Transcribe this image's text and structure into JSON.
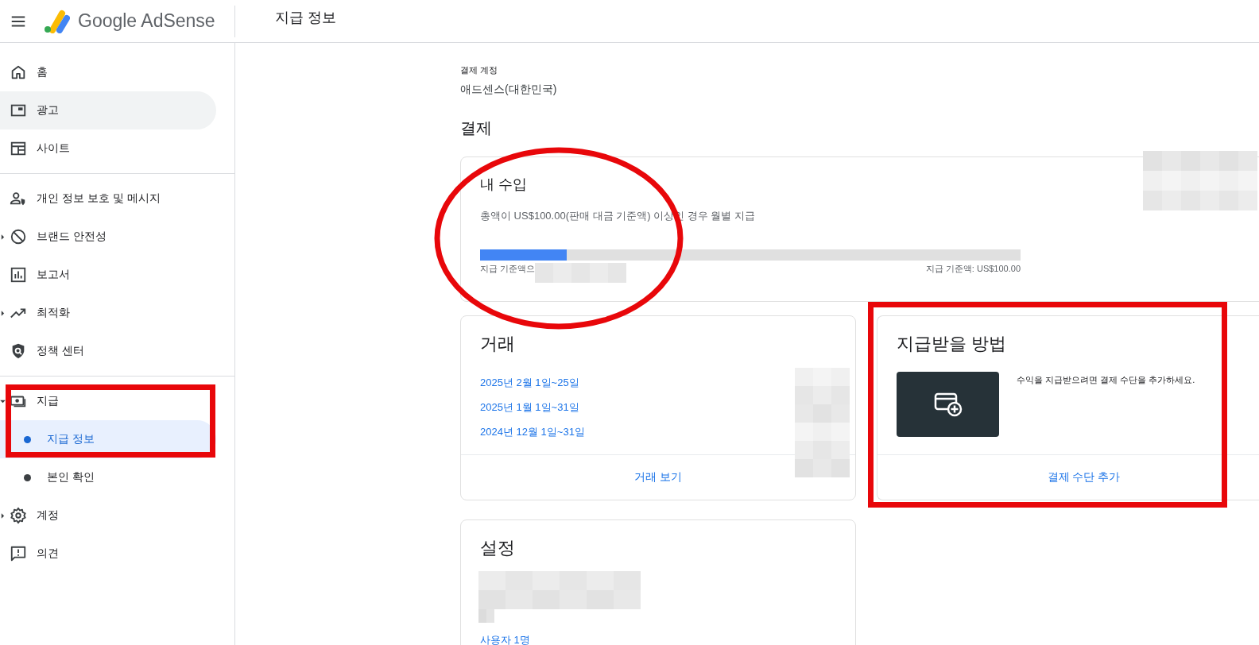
{
  "app": {
    "product_name": "Google AdSense"
  },
  "header": {
    "title": "지급 정보"
  },
  "sidebar": {
    "sections": [
      [
        {
          "label": "홈",
          "hovered": false,
          "expandable": false
        },
        {
          "label": "광고",
          "hovered": true,
          "expandable": false
        },
        {
          "label": "사이트",
          "hovered": false,
          "expandable": false
        }
      ],
      [
        {
          "label": "개인 정보 보호 및 메시지",
          "hovered": false,
          "expandable": false
        },
        {
          "label": "브랜드 안전성",
          "hovered": false,
          "expandable": true,
          "expanded": false
        },
        {
          "label": "보고서",
          "hovered": false,
          "expandable": false
        },
        {
          "label": "최적화",
          "hovered": false,
          "expandable": true,
          "expanded": false
        },
        {
          "label": "정책 센터",
          "hovered": false,
          "expandable": false
        }
      ],
      [
        {
          "label": "지급",
          "hovered": false,
          "expandable": true,
          "expanded": true,
          "children": [
            {
              "label": "지급 정보",
              "selected": true
            },
            {
              "label": "본인 확인",
              "selected": false
            }
          ]
        },
        {
          "label": "계정",
          "hovered": false,
          "expandable": true,
          "expanded": false
        },
        {
          "label": "의견",
          "hovered": false,
          "expandable": false
        }
      ]
    ]
  },
  "main": {
    "account_label": "결제 계정",
    "account_name": "애드센스(대한민국)",
    "section_title": "결제",
    "earnings": {
      "title": "내 수입",
      "description": "총액이 US$100.00(판매 대금 기준액) 이상인 경우 월별 지급",
      "progress": {
        "level": 0.16
      },
      "balance_label": "지급 기준액으",
      "threshold_label": "지급 기준액: US$100.00"
    },
    "transactions": {
      "title": "거래",
      "rows": [
        {
          "period": "2025년 2월 1일~25일"
        },
        {
          "period": "2025년 1월 1일~31일"
        },
        {
          "period": "2024년 12월 1일~31일"
        }
      ],
      "link": "거래 보기"
    },
    "payment_method": {
      "title": "지급받을 방법",
      "message": "수익을 지급받으려면 결제 수단을 추가하세요.",
      "action": "결제 수단 추가"
    },
    "settings": {
      "title": "설정",
      "link": "사용자 1명"
    }
  }
}
